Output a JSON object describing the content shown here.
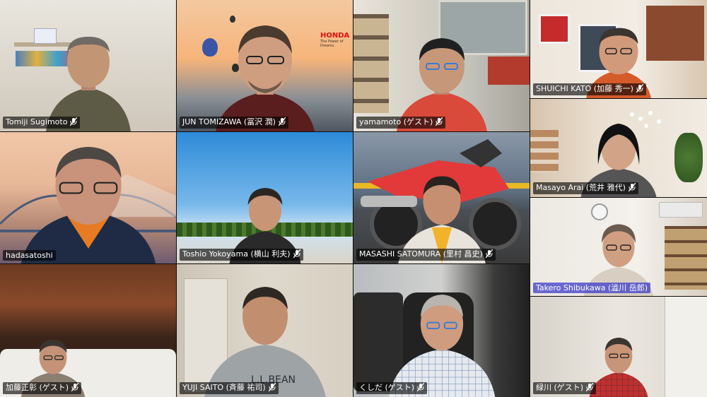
{
  "participants": [
    {
      "name": "Tomiji Sugimoto",
      "mic": "mic-muted-icon"
    },
    {
      "name": "JUN TOMIZAWA (冨沢 潤)",
      "mic": "mic-muted-icon"
    },
    {
      "name": "yamamoto (ゲスト)",
      "mic": "mic-muted-icon"
    },
    {
      "name": "SHUICHI KATO (加藤 秀一)",
      "mic": "mic-muted-icon"
    },
    {
      "name": "Masayo Arai (荒井 雅代)",
      "mic": "mic-muted-icon"
    },
    {
      "name": "hadasatoshi",
      "mic": "none"
    },
    {
      "name": "Toshio Yokoyama (横山 利夫)",
      "mic": "mic-muted-icon"
    },
    {
      "name": "MASASHI SATOMURA (里村 昌史)",
      "mic": "mic-muted-icon"
    },
    {
      "name": "Takero Shibukawa (澁川 岳郎)",
      "mic": "none"
    },
    {
      "name": "加藤正彰 (ゲスト)",
      "mic": "mic-muted-icon"
    },
    {
      "name": "YUJI SAITO (斉藤 祐司)",
      "mic": "mic-muted-icon"
    },
    {
      "name": "くしだ (ゲスト)",
      "mic": "mic-muted-icon"
    },
    {
      "name": "緑川 (ゲスト)",
      "mic": "mic-muted-icon"
    }
  ],
  "background_text": {
    "honda_logo": "HONDA",
    "honda_tagline": "The Power of Dreams"
  },
  "colors": {
    "active_speaker_highlight": "#6a5acd",
    "label_background": "rgba(0,0,0,0.62)"
  }
}
